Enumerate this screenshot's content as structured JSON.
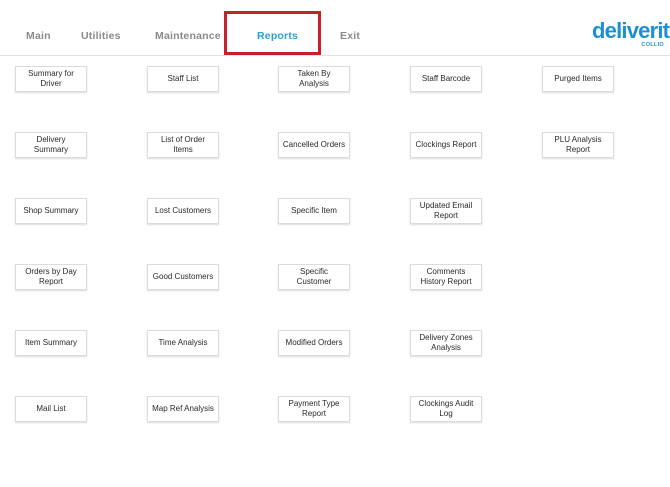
{
  "nav": {
    "tabs": [
      {
        "label": "Main"
      },
      {
        "label": "Utilities"
      },
      {
        "label": "Maintenance"
      },
      {
        "label": "Reports",
        "active": true
      },
      {
        "label": "Exit"
      }
    ],
    "active_color": "#2a9fd6",
    "inactive_color": "#8a8a8a"
  },
  "logo": {
    "text": "deliverit",
    "subtext": "COLLIO",
    "color": "#1d8fd4"
  },
  "highlight_color": "#c8202a",
  "reports": {
    "col1": [
      "Summary for Driver",
      "Delivery Summary",
      "Shop Summary",
      "Orders by Day Report",
      "Item Summary",
      "Mail List"
    ],
    "col2": [
      "Staff List",
      "List of Order Items",
      "Lost Customers",
      "Good Customers",
      "Time Analysis",
      "Map Ref Analysis"
    ],
    "col3": [
      "Taken By Analysis",
      "Cancelled Orders",
      "Specific Item",
      "Specific Customer",
      "Modified Orders",
      "Payment Type Report"
    ],
    "col4": [
      "Staff Barcode",
      "Clockings Report",
      "Updated Email Report",
      "Comments History Report",
      "Delivery Zones Analysis",
      "Clockings Audit Log"
    ],
    "col5": [
      "Purged Items",
      "PLU Analysis Report"
    ]
  }
}
